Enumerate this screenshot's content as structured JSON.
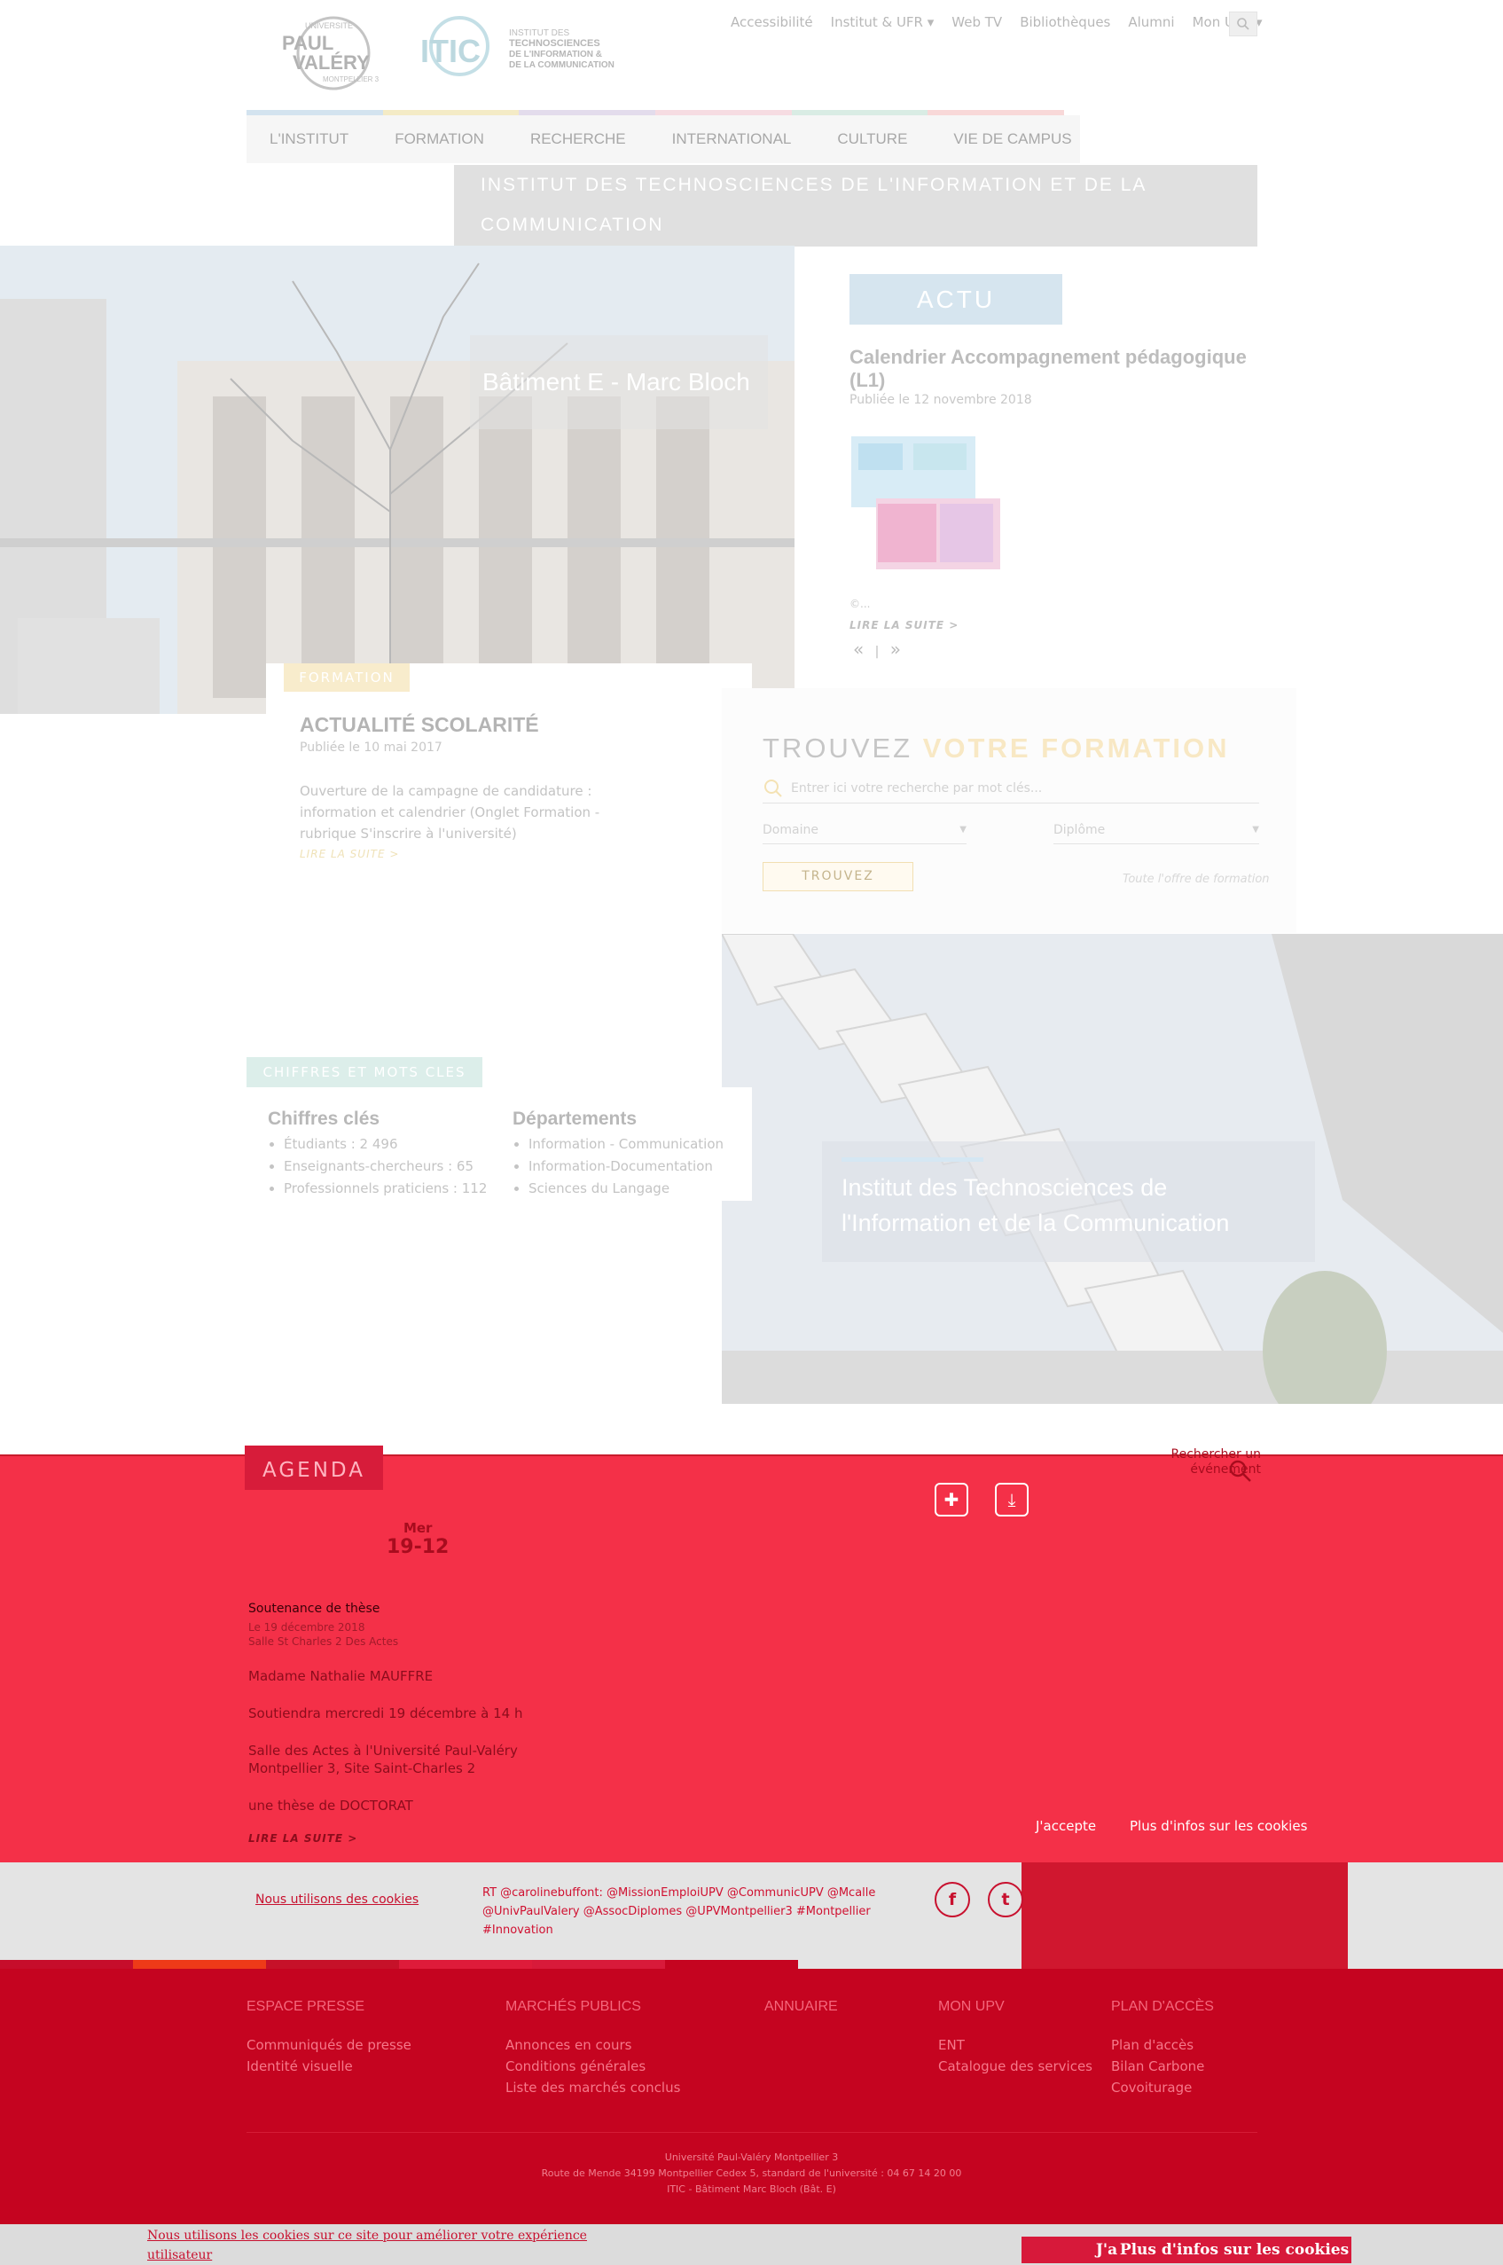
{
  "header": {
    "logo_upv_lines": [
      "UNIVERSITÉ",
      "PAUL",
      "VALÉRY",
      "MONTPELLIER 3"
    ],
    "logo_itic_mark": "ITIC",
    "logo_itic_lines": [
      "INSTITUT DES",
      "TECHNOSCIENCES",
      "DE L'INFORMATION &",
      "DE LA COMMUNICATION"
    ],
    "top_links": [
      "Accessibilité",
      "Institut & UFR ▾",
      "Web TV",
      "Bibliothèques",
      "Alumni",
      "Mon UPV ▾"
    ],
    "main_nav": [
      "L'INSTITUT",
      "FORMATION",
      "RECHERCHE",
      "INTERNATIONAL",
      "CULTURE",
      "VIE DE CAMPUS"
    ],
    "nav_colors": [
      "#d3e3ef",
      "#f4ebc6",
      "#e3dcec",
      "#f6dce2",
      "#d9ece4",
      "#f8d8d8"
    ],
    "institute_title": "INSTITUT DES TECHNOSCIENCES DE L'INFORMATION ET DE LA COMMUNICATION"
  },
  "hero": {
    "caption": "Bâtiment E - Marc Bloch"
  },
  "actu": {
    "heading": "ACTU",
    "title": "Calendrier Accompagnement pédagogique (L1)",
    "date": "Publiée le 12 novembre 2018",
    "excerpt": "©...",
    "more": "LIRE LA SUITE  >",
    "prev": "«",
    "sep": "|",
    "next": "»"
  },
  "news": {
    "tag": "FORMATION",
    "title": "ACTUALITÉ SCOLARITÉ",
    "date": "Publiée le 10 mai 2017",
    "body": " Ouverture de la campagne de candidature : information et calendrier (Onglet Formation - rubrique S'inscrire à l'université)",
    "more": "LIRE LA SUITE  >"
  },
  "finder": {
    "title_a": "TROUVEZ ",
    "title_b": "VOTRE FORMATION",
    "placeholder": "Entrer ici votre recherche par mot clés...",
    "domain": "Domaine",
    "diploma": "Diplôme",
    "button": "TROUVEZ",
    "all": "Toute l'offre de formation"
  },
  "building": {
    "caption": "Institut des Technosciences de l'Information et de la Communication"
  },
  "chiffres": {
    "tag": "CHIFFRES ET MOTS CLES",
    "col1_title": "Chiffres clés",
    "col1": [
      "Étudiants : 2 496",
      "Enseignants-chercheurs : 65",
      "Professionnels praticiens : 112"
    ],
    "col2_title": "Départements",
    "col2": [
      "Information - Communication",
      "Information-Documentation",
      "Sciences du Langage"
    ]
  },
  "agenda": {
    "tag": "AGENDA",
    "day": "Mer",
    "date": "19-12",
    "search": "Rechercher un événement",
    "event_title": "Soutenance de thèse",
    "event_date": "Le 19 décembre 2018",
    "event_place": "Salle St Charles 2 Des Actes",
    "paras": [
      "Madame Nathalie MAUFFRE",
      "Soutiendra mercredi 19 décembre à 14 h",
      "Salle des Actes à l'Université Paul-Valéry Montpellier 3, Site Saint-Charles 2",
      "une thèse de DOCTORAT"
    ],
    "more": "LIRE LA SUITE  >"
  },
  "social": {
    "cookie_link": "Nous utilisons des cookies",
    "tweet": "RT @carolinebuffont: @MissionEmploiUPV @CommunicUPV @Mcalle @UnivPaulValery @AssocDiplomes @UPVMontpellier3 #Montpellier #Innovation",
    "accept_small": "J'accepte",
    "more_small": "Plus d'infos sur les cookies"
  },
  "footer": {
    "bar_colors": [
      "#c60d2b",
      "#ee3a18",
      "#c61129",
      "#de1b3a",
      "#d81a3a",
      "#c50420"
    ],
    "cols": [
      {
        "title": "ESPACE PRESSE",
        "links": [
          "Communiqués de presse",
          "Identité visuelle"
        ]
      },
      {
        "title": "MARCHÉS PUBLICS",
        "links": [
          "Annonces en cours",
          "Conditions générales",
          "Liste des marchés conclus"
        ]
      },
      {
        "title": "ANNUAIRE",
        "links": []
      },
      {
        "title": "MON UPV",
        "links": [
          "ENT",
          "Catalogue des services"
        ]
      },
      {
        "title": "PLAN D'ACCÈS",
        "links": [
          "Plan d'accès",
          "Bilan Carbone",
          "Covoiturage"
        ]
      }
    ],
    "address1": "Université Paul-Valéry Montpellier 3",
    "address2": "Route de Mende 34199 Montpellier Cedex 5, standard de l'université : 04 67 14 20 00",
    "address3": "ITIC - Bâtiment Marc Bloch (Bât. E)"
  },
  "cookies": {
    "text": "Nous utilisons les cookies sur ce site pour améliorer votre expérience utilisateur",
    "accept": "J'accepte",
    "more": "Plus d'infos sur les cookies"
  }
}
